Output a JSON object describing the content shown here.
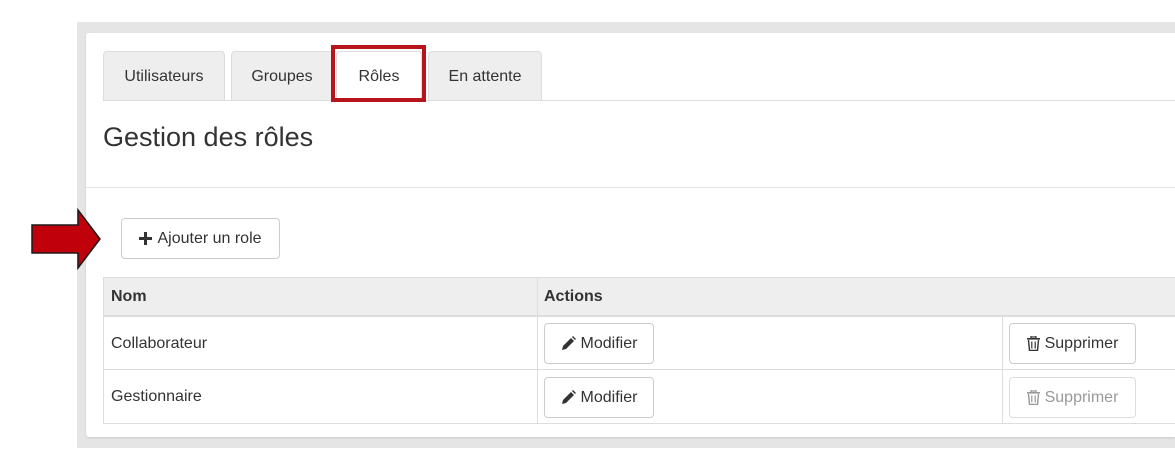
{
  "tabs": [
    {
      "label": "Utilisateurs"
    },
    {
      "label": "Groupes"
    },
    {
      "label": "Rôles"
    },
    {
      "label": "En attente"
    }
  ],
  "active_tab": "Rôles",
  "page_title": "Gestion des rôles",
  "add_button": {
    "label": "Ajouter un role",
    "icon": "plus-icon"
  },
  "table": {
    "headers": {
      "name": "Nom",
      "actions": "Actions"
    },
    "rows": [
      {
        "name": "Collaborateur",
        "edit_label": "Modifier",
        "delete_label": "Supprimer",
        "delete_enabled": true
      },
      {
        "name": "Gestionnaire",
        "edit_label": "Modifier",
        "delete_label": "Supprimer",
        "delete_enabled": false
      }
    ]
  },
  "colors": {
    "highlight": "#b8141c",
    "arrow": "#c0000b"
  }
}
